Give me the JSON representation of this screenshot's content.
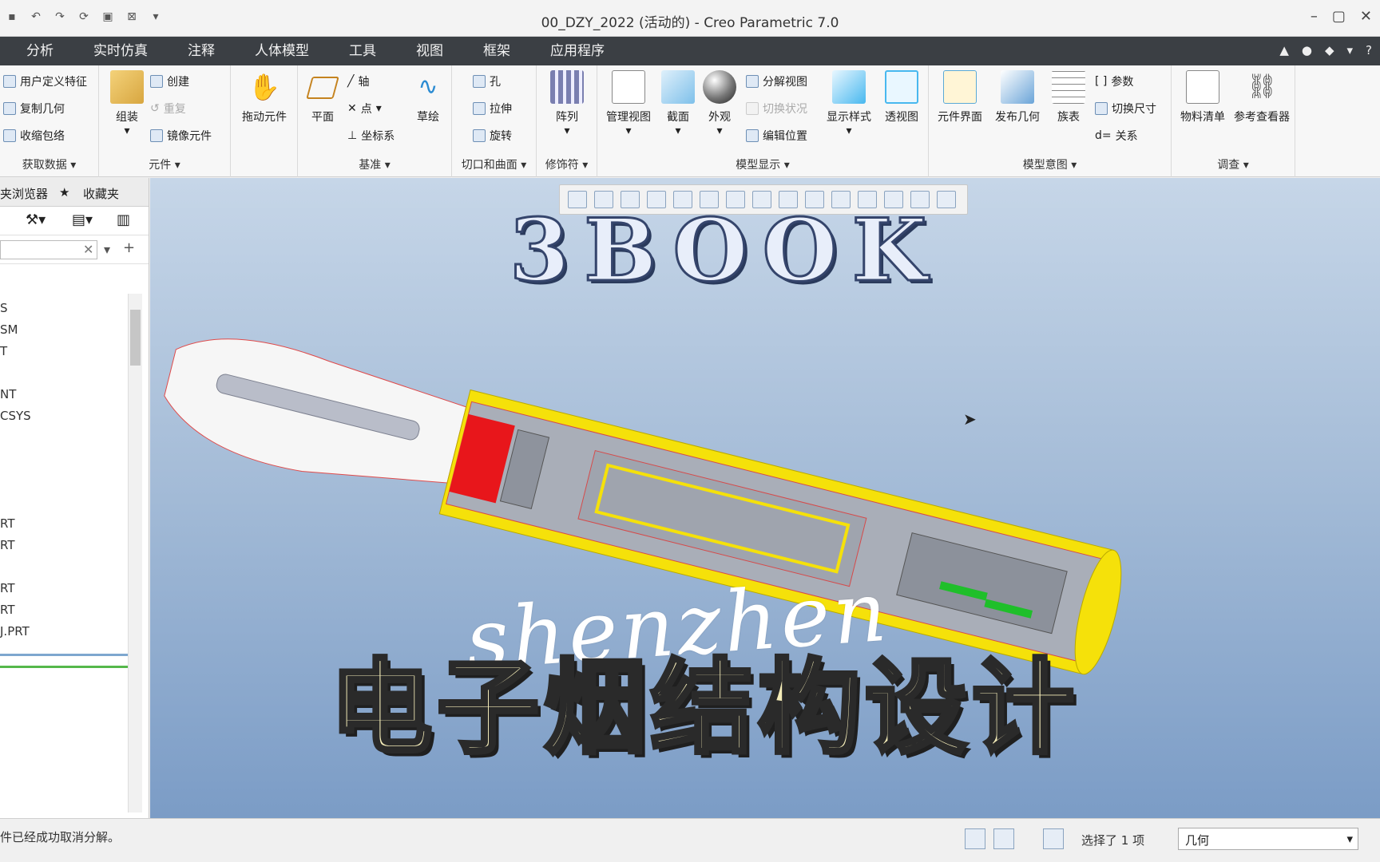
{
  "window": {
    "title": "00_DZY_2022 (活动的) - Creo Parametric 7.0"
  },
  "menu": {
    "tabs": [
      "分析",
      "实时仿真",
      "注释",
      "人体模型",
      "工具",
      "视图",
      "框架",
      "应用程序"
    ]
  },
  "ribbon": {
    "get_data": {
      "items": [
        "用户定义特征",
        "复制几何",
        "收缩包络"
      ],
      "label": "获取数据"
    },
    "components": {
      "assemble": "组装",
      "create": "创建",
      "repeat": "重复",
      "mirror": "镜像元件",
      "label": "元件"
    },
    "drag": {
      "label": "拖动元件"
    },
    "datum": {
      "plane": "平面",
      "axis": "轴",
      "point": "点",
      "csys": "坐标系",
      "sketch": "草绘",
      "label": "基准"
    },
    "cut_surface": {
      "hole": "孔",
      "extrude": "拉伸",
      "revolve": "旋转",
      "label": "切口和曲面"
    },
    "modifiers": {
      "pattern": "阵列",
      "label": "修饰符"
    },
    "model_display": {
      "manage_views": "管理视图",
      "section": "截面",
      "appearance": "外观",
      "explode": "分解视图",
      "toggle_state": "切换状况",
      "edit_position": "编辑位置",
      "display_style": "显示样式",
      "perspective": "透视图",
      "label": "模型显示"
    },
    "model_intent": {
      "component_interface": "元件界面",
      "publish_geometry": "发布几何",
      "family_table": "族表",
      "parameters": "参数",
      "toggle_dims": "切换尺寸",
      "relations": "关系",
      "label": "模型意图"
    },
    "investigate": {
      "bom": "物料清单",
      "reference_viewer": "参考查看器",
      "label": "调查"
    }
  },
  "left_panel": {
    "tab_browser": "夹浏览器",
    "tab_favorites": "收藏夹",
    "tree_items": [
      "S",
      "SM",
      "T",
      "",
      "NT",
      "CSYS",
      "",
      "",
      "",
      "",
      "RT",
      "RT",
      "",
      "RT",
      "RT",
      "J.PRT"
    ]
  },
  "viewport": {
    "overlay_title": "3BOOK",
    "overlay_script": "shenzhen",
    "overlay_caption": "电子烟结构设计"
  },
  "status": {
    "message": "件已经成功取消分解。",
    "selection": "选择了 1 项",
    "filter": "几何"
  },
  "colors": {
    "menubar": "#3b3f44",
    "housing_yellow": "#f5e10a",
    "seal_red": "#e8161b",
    "board_green": "#1fbf2a"
  }
}
